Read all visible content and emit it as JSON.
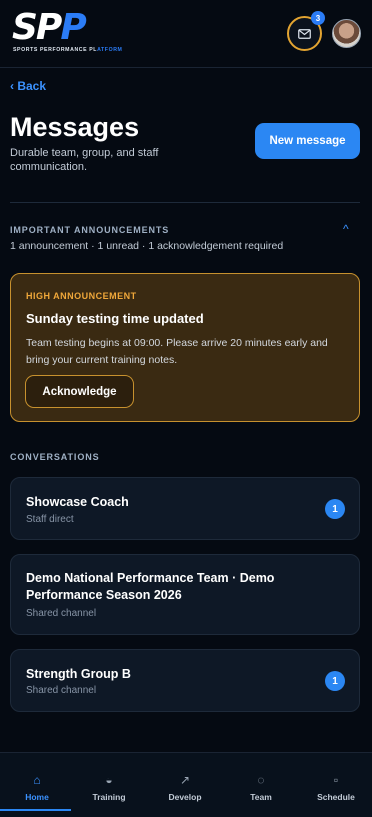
{
  "header": {
    "logo_letters_white": "SP",
    "logo_letters_blue": "P",
    "logo_subtitle_main": "SPORTS PERFORMANCE PL",
    "logo_subtitle_accent": "ATFORM",
    "mail_badge_count": "3",
    "mail_icon": "mail-icon"
  },
  "page": {
    "back_label": "‹ Back",
    "title": "Messages",
    "subtitle": "Durable team, group, and staff communication.",
    "new_message_label": "New message"
  },
  "announcements": {
    "heading": "IMPORTANT ANNOUNCEMENTS",
    "caret": "^",
    "summary": "1 announcement · 1 unread · 1 acknowledgement required",
    "card": {
      "tag": "HIGH ANNOUNCEMENT",
      "title": "Sunday testing time updated",
      "body": "Team testing begins at 09:00. Please arrive 20 minutes early and bring your current training notes.",
      "acknowledge_label": "Acknowledge"
    }
  },
  "conversations": {
    "heading": "CONVERSATIONS",
    "items": [
      {
        "title": "Showcase Coach",
        "subtitle": "Staff direct",
        "unread": "1"
      },
      {
        "title": "Demo National Performance Team · Demo Performance Season 2026",
        "subtitle": "Shared channel",
        "unread": ""
      },
      {
        "title": "Strength Group B",
        "subtitle": "Shared channel",
        "unread": "1"
      }
    ]
  },
  "nav": {
    "items": [
      {
        "label": "Home",
        "icon": "⌂",
        "icon_name": "home-icon"
      },
      {
        "label": "Training",
        "icon": "◒",
        "icon_name": "training-icon"
      },
      {
        "label": "Develop",
        "icon": "↗",
        "icon_name": "develop-icon"
      },
      {
        "label": "Team",
        "icon": "◌",
        "icon_name": "team-icon"
      },
      {
        "label": "Schedule",
        "icon": "▫",
        "icon_name": "schedule-icon"
      }
    ],
    "active": "Home"
  },
  "colors": {
    "accent": "#2b87f3",
    "announcement": "#c7912e",
    "background": "#050a12"
  }
}
